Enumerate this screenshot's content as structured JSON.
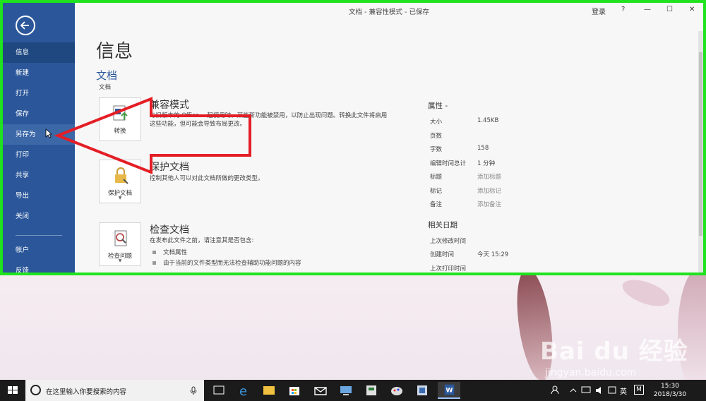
{
  "window": {
    "title": "文档 - 兼容性模式 - 已保存",
    "login": "登录",
    "help": "?",
    "minimize": "—",
    "maximize": "☐",
    "close": "✕"
  },
  "nav": {
    "items": [
      "信息",
      "新建",
      "打开",
      "保存",
      "另存为",
      "打印",
      "共享",
      "导出",
      "关闭"
    ],
    "bottom_items": [
      "帐户",
      "反馈"
    ]
  },
  "info": {
    "page_title": "信息",
    "doc_heading": "文档",
    "doc_path": "文档",
    "sections": [
      {
        "button_label": "转换",
        "title": "兼容模式",
        "desc": "与旧版本的 Office 一起使用时，某些新功能被禁用，以防止出现问题。转换此文件将启用这些功能，但可能会导致布局更改。"
      },
      {
        "button_label": "保护文档",
        "title": "保护文档",
        "desc": "控制其他人可以对此文档所做的更改类型。"
      },
      {
        "button_label": "检查问题",
        "title": "检查文档",
        "desc": "在发布此文件之前，请注意其是否包含:",
        "bullets": [
          "文档属性",
          "由于当前的文件类型而无法检查辅助功能问题的内容"
        ]
      }
    ]
  },
  "properties": {
    "heading": "属性 -",
    "rows": [
      {
        "k": "大小",
        "v": "1.45KB"
      },
      {
        "k": "页数",
        "v": ""
      },
      {
        "k": "字数",
        "v": "158"
      },
      {
        "k": "编辑时间总计",
        "v": "1 分钟"
      },
      {
        "k": "标题",
        "v": "添加标题"
      },
      {
        "k": "标记",
        "v": "添加标记"
      },
      {
        "k": "备注",
        "v": "添加备注"
      }
    ],
    "dates_heading": "相关日期",
    "date_rows": [
      {
        "k": "上次修改时间",
        "v": ""
      },
      {
        "k": "创建时间",
        "v": "今天 15:29"
      },
      {
        "k": "上次打印时间",
        "v": ""
      }
    ]
  },
  "desktop": {
    "watermark": "Bai du 经验",
    "watermark_sub": "jingyan.baidu.com"
  },
  "taskbar": {
    "search_placeholder": "在这里输入你要搜索的内容",
    "ime": "英",
    "ime2": "M",
    "time": "15:30",
    "date": "2018/3/30"
  },
  "colors": {
    "backstage": "#2b579a",
    "highlight_border": "#1ee31e",
    "arrow": "#e41e26"
  }
}
